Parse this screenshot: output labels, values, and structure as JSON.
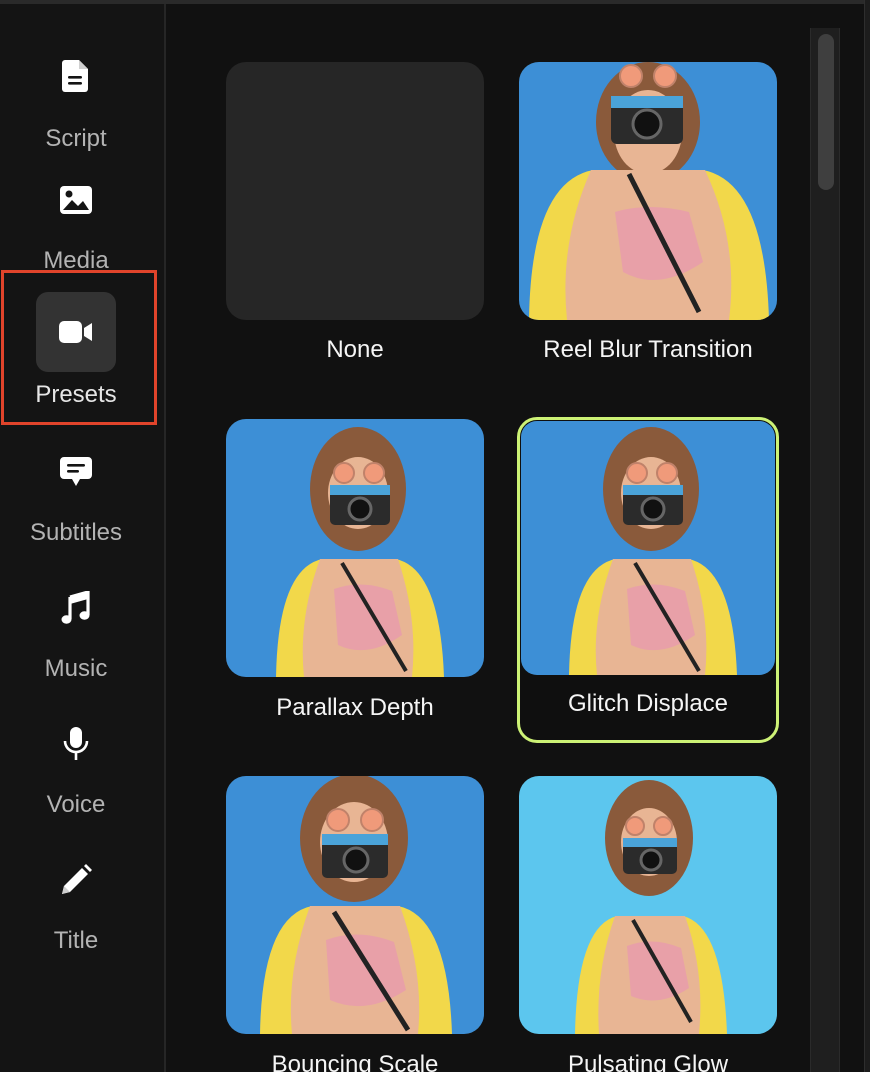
{
  "sidebar": {
    "items": [
      {
        "label": "Script",
        "icon": "document-icon",
        "active": false
      },
      {
        "label": "Media",
        "icon": "image-icon",
        "active": false
      },
      {
        "label": "Presets",
        "icon": "video-camera-icon",
        "active": true
      },
      {
        "label": "Subtitles",
        "icon": "speech-bubble-icon",
        "active": false
      },
      {
        "label": "Music",
        "icon": "music-note-icon",
        "active": false
      },
      {
        "label": "Voice",
        "icon": "microphone-icon",
        "active": false
      },
      {
        "label": "Title",
        "icon": "pencil-icon",
        "active": false
      }
    ],
    "highlight_color": "#e0442b"
  },
  "presets": [
    {
      "label": "None",
      "selected": false,
      "has_thumbnail": false
    },
    {
      "label": "Reel Blur Transition",
      "selected": false,
      "has_thumbnail": true
    },
    {
      "label": "Parallax Depth",
      "selected": false,
      "has_thumbnail": true
    },
    {
      "label": "Glitch Displace",
      "selected": true,
      "has_thumbnail": true
    },
    {
      "label": "Bouncing Scale",
      "selected": false,
      "has_thumbnail": true
    },
    {
      "label": "Pulsating Glow",
      "selected": false,
      "has_thumbnail": true
    }
  ],
  "colors": {
    "background": "#111111",
    "selected_border": "#cdf276",
    "thumbnail_bg": "#3d8fd6",
    "thumbnail_bg_light": "#5cc6ee"
  }
}
